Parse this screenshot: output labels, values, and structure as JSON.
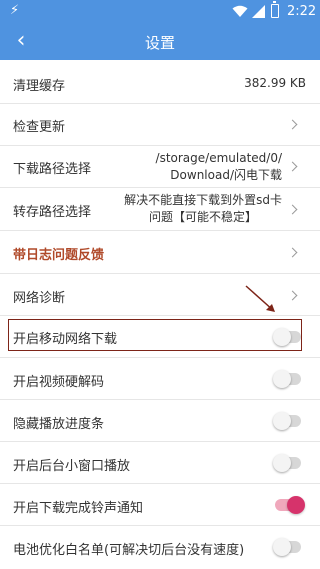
{
  "status_bar": {
    "time": "2:22",
    "icons": [
      "flash-icon",
      "wifi-icon",
      "signal-icon",
      "battery-icon"
    ]
  },
  "app_bar": {
    "title": "设置",
    "back_icon": "chevron-left-icon"
  },
  "colors": {
    "primary": "#4f93e0",
    "accent": "#d6336b",
    "highlight": "#7d2418",
    "feedback": "#b04a2a"
  },
  "settings": [
    {
      "id": "clear-cache",
      "label": "清理缓存",
      "value": "382.99 KB"
    },
    {
      "id": "check-update",
      "label": "检查更新"
    },
    {
      "id": "download-path",
      "label": "下载路径选择",
      "value_lines": [
        "/storage/emulated/0/",
        "Download/闪电下载"
      ]
    },
    {
      "id": "transfer-path",
      "label": "转存路径选择",
      "value_lines": [
        "解决不能直接下载到外置sd卡",
        "问题【可能不稳定】"
      ]
    },
    {
      "id": "log-feedback",
      "label": "带日志问题反馈"
    },
    {
      "id": "network-diagnosis",
      "label": "网络诊断"
    },
    {
      "id": "mobile-download",
      "label": "开启移动网络下载",
      "toggle": false,
      "highlighted": true
    },
    {
      "id": "hw-decode",
      "label": "开启视频硬解码",
      "toggle": false
    },
    {
      "id": "hide-progress",
      "label": "隐藏播放进度条",
      "toggle": false
    },
    {
      "id": "pip-play",
      "label": "开启后台小窗口播放",
      "toggle": false
    },
    {
      "id": "download-ringtone",
      "label": "开启下载完成铃声通知",
      "toggle": true
    },
    {
      "id": "battery-whitelist",
      "label": "电池优化白名单(可解决切后台没有速度)",
      "toggle": false
    }
  ]
}
